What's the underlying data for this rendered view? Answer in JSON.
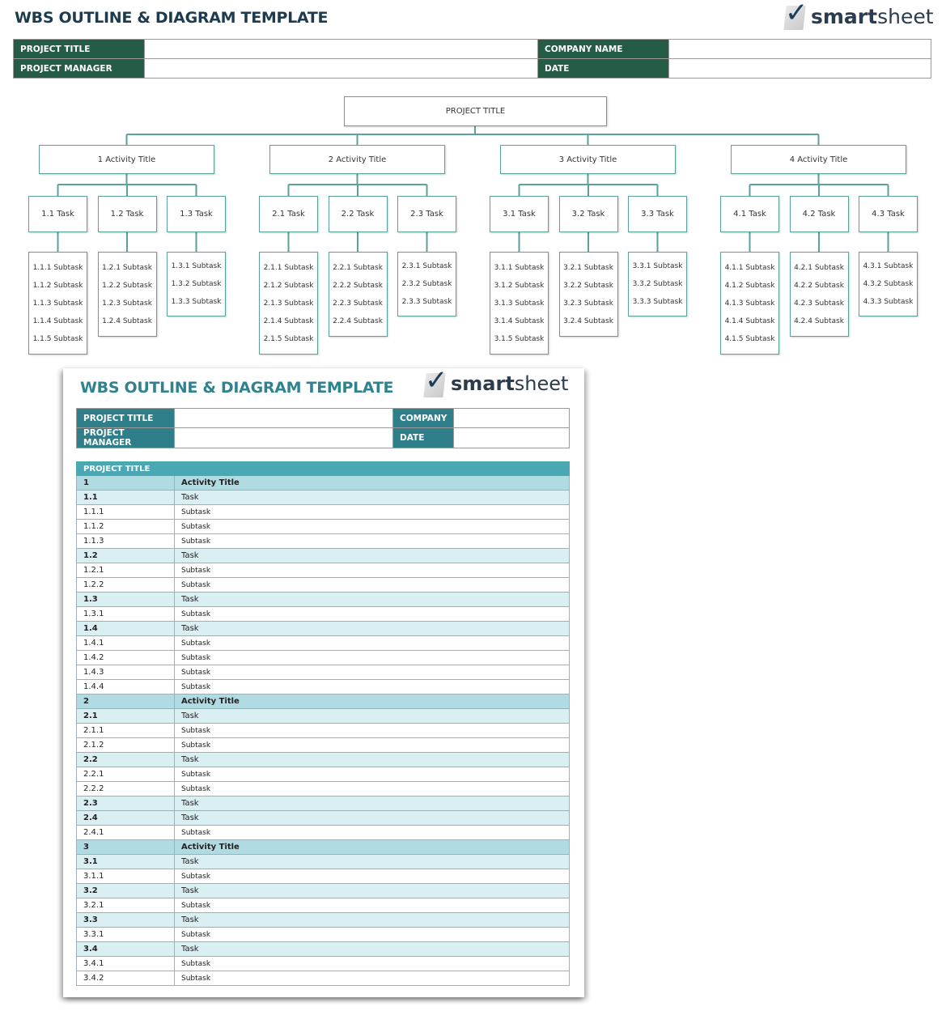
{
  "header": {
    "title": "WBS OUTLINE & DIAGRAM TEMPLATE",
    "logo_text_bold": "smart",
    "logo_text_light": "sheet",
    "logo_icon": "checkmark-icon",
    "fields": {
      "project_title_label": "PROJECT TITLE",
      "project_title_value": "",
      "project_manager_label": "PROJECT MANAGER",
      "project_manager_value": "",
      "company_label": "COMPANY NAME",
      "company_value": "",
      "date_label": "DATE",
      "date_value": ""
    }
  },
  "colors": {
    "header_label_bg": "#245c46",
    "title_text": "#1d3b4f",
    "diagram_line": "#5aa39a",
    "outline_header_bg": "#4aa8b4",
    "activity_row_bg": "#b1dbe2",
    "task_row_bg": "#d9eff2",
    "outline_title": "#2f8390"
  },
  "diagram": {
    "root": "PROJECT TITLE",
    "activities": [
      {
        "label": "1 Activity Title",
        "tasks": [
          {
            "label": "1.1 Task",
            "subtasks": [
              "1.1.1 Subtask",
              "1.1.2 Subtask",
              "1.1.3 Subtask",
              "1.1.4 Subtask",
              "1.1.5 Subtask"
            ]
          },
          {
            "label": "1.2 Task",
            "subtasks": [
              "1.2.1 Subtask",
              "1.2.2 Subtask",
              "1.2.3 Subtask",
              "1.2.4 Subtask"
            ]
          },
          {
            "label": "1.3 Task",
            "subtasks": [
              "1.3.1 Subtask",
              "1.3.2 Subtask",
              "1.3.3 Subtask"
            ]
          }
        ]
      },
      {
        "label": "2 Activity Title",
        "tasks": [
          {
            "label": "2.1 Task",
            "subtasks": [
              "2.1.1 Subtask",
              "2.1.2 Subtask",
              "2.1.3 Subtask",
              "2.1.4 Subtask",
              "2.1.5 Subtask"
            ]
          },
          {
            "label": "2.2 Task",
            "subtasks": [
              "2.2.1 Subtask",
              "2.2.2 Subtask",
              "2.2.3 Subtask",
              "2.2.4 Subtask"
            ]
          },
          {
            "label": "2.3 Task",
            "subtasks": [
              "2.3.1 Subtask",
              "2.3.2 Subtask",
              "2.3.3 Subtask"
            ]
          }
        ]
      },
      {
        "label": "3 Activity Title",
        "tasks": [
          {
            "label": "3.1 Task",
            "subtasks": [
              "3.1.1 Subtask",
              "3.1.2 Subtask",
              "3.1.3 Subtask",
              "3.1.4 Subtask",
              "3.1.5 Subtask"
            ]
          },
          {
            "label": "3.2 Task",
            "subtasks": [
              "3.2.1 Subtask",
              "3.2.2 Subtask",
              "3.2.3 Subtask",
              "3.2.4 Subtask"
            ]
          },
          {
            "label": "3.3 Task",
            "subtasks": [
              "3.3.1 Subtask",
              "3.3.2 Subtask",
              "3.3.3 Subtask"
            ]
          }
        ]
      },
      {
        "label": "4 Activity Title",
        "tasks": [
          {
            "label": "4.1 Task",
            "subtasks": [
              "4.1.1 Subtask",
              "4.1.2 Subtask",
              "4.1.3 Subtask",
              "4.1.4 Subtask",
              "4.1.5 Subtask"
            ]
          },
          {
            "label": "4.2 Task",
            "subtasks": [
              "4.2.1 Subtask",
              "4.2.2 Subtask",
              "4.2.3 Subtask",
              "4.2.4 Subtask"
            ]
          },
          {
            "label": "4.3 Task",
            "subtasks": [
              "4.3.1 Subtask",
              "4.3.2 Subtask",
              "4.3.3 Subtask"
            ]
          }
        ]
      }
    ]
  },
  "outline_page": {
    "title": "WBS OUTLINE & DIAGRAM TEMPLATE",
    "logo_text_bold": "smart",
    "logo_text_light": "sheet",
    "fields": {
      "project_title_label": "PROJECT TITLE",
      "project_title_value": "",
      "project_manager_label": "PROJECT MANAGER",
      "project_manager_value": "",
      "company_label": "COMPANY",
      "company_value": "",
      "date_label": "DATE",
      "date_value": ""
    },
    "table_header": "PROJECT TITLE",
    "rows": [
      {
        "level": "activity",
        "num": "1",
        "desc": "Activity Title"
      },
      {
        "level": "task",
        "num": "1.1",
        "desc": "Task"
      },
      {
        "level": "subtask",
        "num": "1.1.1",
        "desc": "Subtask"
      },
      {
        "level": "subtask",
        "num": "1.1.2",
        "desc": "Subtask"
      },
      {
        "level": "subtask",
        "num": "1.1.3",
        "desc": "Subtask"
      },
      {
        "level": "task",
        "num": "1.2",
        "desc": "Task"
      },
      {
        "level": "subtask",
        "num": "1.2.1",
        "desc": "Subtask"
      },
      {
        "level": "subtask",
        "num": "1.2.2",
        "desc": "Subtask"
      },
      {
        "level": "task",
        "num": "1.3",
        "desc": "Task"
      },
      {
        "level": "subtask",
        "num": "1.3.1",
        "desc": "Subtask"
      },
      {
        "level": "task",
        "num": "1.4",
        "desc": "Task"
      },
      {
        "level": "subtask",
        "num": "1.4.1",
        "desc": "Subtask"
      },
      {
        "level": "subtask",
        "num": "1.4.2",
        "desc": "Subtask"
      },
      {
        "level": "subtask",
        "num": "1.4.3",
        "desc": "Subtask"
      },
      {
        "level": "subtask",
        "num": "1.4.4",
        "desc": "Subtask"
      },
      {
        "level": "activity",
        "num": "2",
        "desc": "Activity Title"
      },
      {
        "level": "task",
        "num": "2.1",
        "desc": "Task"
      },
      {
        "level": "subtask",
        "num": "2.1.1",
        "desc": "Subtask"
      },
      {
        "level": "subtask",
        "num": "2.1.2",
        "desc": "Subtask"
      },
      {
        "level": "task",
        "num": "2.2",
        "desc": "Task"
      },
      {
        "level": "subtask",
        "num": "2.2.1",
        "desc": "Subtask"
      },
      {
        "level": "subtask",
        "num": "2.2.2",
        "desc": "Subtask"
      },
      {
        "level": "task",
        "num": "2.3",
        "desc": "Task"
      },
      {
        "level": "task",
        "num": "2.4",
        "desc": "Task"
      },
      {
        "level": "subtask",
        "num": "2.4.1",
        "desc": "Subtask"
      },
      {
        "level": "activity",
        "num": "3",
        "desc": "Activity Title"
      },
      {
        "level": "task",
        "num": "3.1",
        "desc": "Task"
      },
      {
        "level": "subtask",
        "num": "3.1.1",
        "desc": "Subtask"
      },
      {
        "level": "task",
        "num": "3.2",
        "desc": "Task"
      },
      {
        "level": "subtask",
        "num": "3.2.1",
        "desc": "Subtask"
      },
      {
        "level": "task",
        "num": "3.3",
        "desc": "Task"
      },
      {
        "level": "subtask",
        "num": "3.3.1",
        "desc": "Subtask"
      },
      {
        "level": "task",
        "num": "3.4",
        "desc": "Task"
      },
      {
        "level": "subtask",
        "num": "3.4.1",
        "desc": "Subtask"
      },
      {
        "level": "subtask",
        "num": "3.4.2",
        "desc": "Subtask"
      }
    ]
  }
}
